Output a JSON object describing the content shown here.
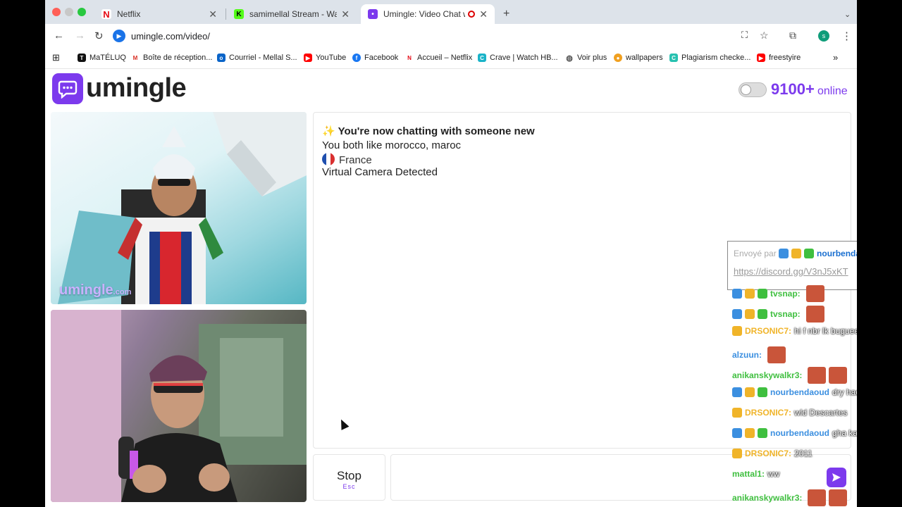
{
  "tabs": [
    {
      "title": "Netflix",
      "icon": "netflix-icon",
      "color": "#e50914"
    },
    {
      "title": "samimellal Stream - Watch Li",
      "icon": "kick-icon",
      "color": "#53fc18"
    },
    {
      "title": "Umingle: Video Chat with",
      "icon": "umingle-icon",
      "color": "#7c3aed"
    }
  ],
  "address": {
    "url": "umingle.com/video/"
  },
  "bookmarks": [
    {
      "label": "MaTÉLUQ"
    },
    {
      "label": "Boîte de réception..."
    },
    {
      "label": "Courriel - Mellal S..."
    },
    {
      "label": "YouTube"
    },
    {
      "label": "Facebook"
    },
    {
      "label": "Accueil – Netflix"
    },
    {
      "label": "Crave | Watch HB..."
    },
    {
      "label": "Voir plus"
    },
    {
      "label": "wallpapers"
    },
    {
      "label": "Plagiarism checke..."
    },
    {
      "label": "freestyire"
    }
  ],
  "site": {
    "brand": "umingle",
    "online_count": "9100+",
    "online_label": "online",
    "watermark": "umingle",
    "watermark_suffix": ".com",
    "accent": "#7c3aed"
  },
  "chat": {
    "messages": [
      "✨ You're now chatting with someone new",
      "You both like morocco, maroc",
      "France",
      "Virtual Camera Detected"
    ],
    "stop_label": "Stop",
    "stop_hint": "Esc"
  },
  "overlay": {
    "header_prefix": "Envoyé par",
    "header_user": "nourbendaoud",
    "link": "https://discord.gg/V3nJ5xKT",
    "lines": [
      {
        "user": "tvsnap:",
        "text": "",
        "color": "#3fbf3f"
      },
      {
        "user": "tvsnap:",
        "text": "",
        "color": "#3fbf3f"
      },
      {
        "user": "DRSONIC7:",
        "text": "hi f nbr lk bugueerrrr",
        "color": "#f0b429"
      },
      {
        "user": "alzuun:",
        "text": "",
        "color": "#3b8fe0"
      },
      {
        "user": "anikanskywalkr3:",
        "text": "",
        "color": "#3fbf3f"
      },
      {
        "user": "nourbendaoud",
        "text": "dry hada",
        "color": "#3b8fe0"
      },
      {
        "user": "DRSONIC7:",
        "text": "wld Descartes",
        "color": "#f0b429"
      },
      {
        "user": "nourbendaoud",
        "text": "gha kandhik",
        "color": "#3b8fe0"
      },
      {
        "user": "DRSONIC7:",
        "text": "2011",
        "color": "#f0b429"
      },
      {
        "user": "mattal1:",
        "text": "ww",
        "color": "#3fbf3f"
      },
      {
        "user": "anikanskywalkr3:",
        "text": "",
        "color": "#3fbf3f"
      }
    ]
  }
}
